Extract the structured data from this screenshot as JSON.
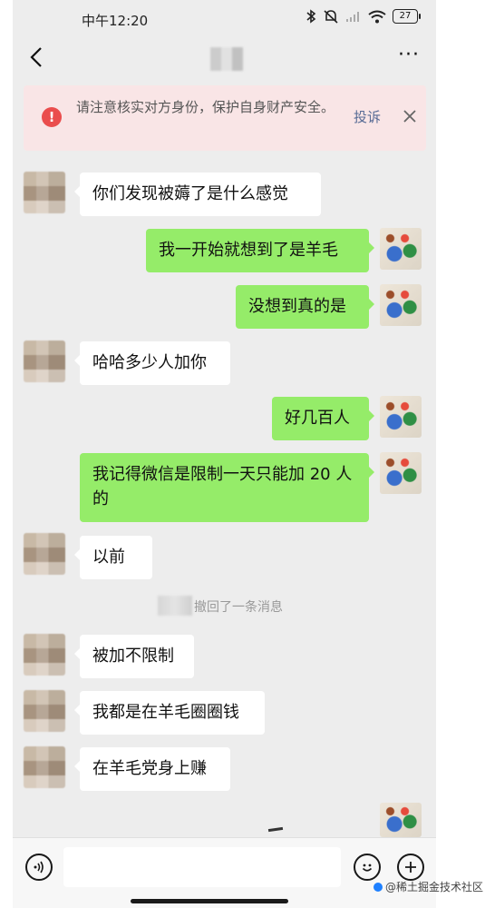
{
  "status_bar": {
    "time": "中午12:20",
    "battery": "27"
  },
  "header": {
    "more_label": "···"
  },
  "warning": {
    "text": "请注意核实对方身份，保护自身财产安全。",
    "report_label": "投诉",
    "accent_color": "#ea4d4d"
  },
  "messages": [
    {
      "from": "other",
      "text": "你们发现被薅了是什么感觉"
    },
    {
      "from": "me",
      "text": "我一开始就想到了是羊毛"
    },
    {
      "from": "me",
      "text": "没想到真的是"
    },
    {
      "from": "other",
      "text": "哈哈多少人加你"
    },
    {
      "from": "me",
      "text": "好几百人"
    },
    {
      "from": "me",
      "text": "我记得微信是限制一天只能加 20 人的"
    },
    {
      "from": "other",
      "text": "以前"
    },
    {
      "from": "other",
      "text": "被加不限制"
    },
    {
      "from": "other",
      "text": "我都是在羊毛圈圈钱"
    },
    {
      "from": "other",
      "text": "在羊毛党身上赚"
    }
  ],
  "system_notice": "撤回了一条消息",
  "input": {
    "value": "",
    "placeholder": ""
  },
  "watermark": "@稀土掘金技术社区",
  "colors": {
    "my_bubble": "#95ec69",
    "other_bubble": "#ffffff",
    "chat_bg": "#ededed",
    "link": "#576b95"
  }
}
